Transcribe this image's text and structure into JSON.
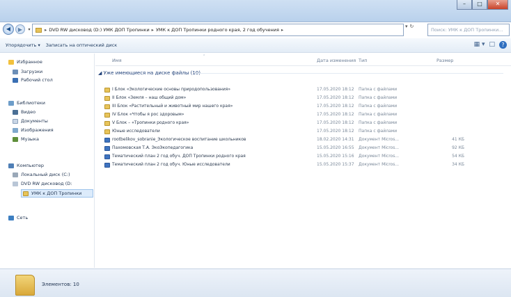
{
  "window": {
    "buttons": {
      "minimize": "–",
      "maximize": "□",
      "close": "✕"
    }
  },
  "nav": {
    "back": "◀",
    "forward": "▶",
    "dropdown": "▾"
  },
  "address": {
    "crumbs": [
      "DVD RW дисковод (D:) УМК ДОП Тропинки",
      "УМК к ДОП Тропинки родного края, 2 год обучения"
    ],
    "separator": "▸",
    "dropdown": "▾",
    "refresh": "↻",
    "search_placeholder": "Поиск: УМК к ДОП Тропинки..."
  },
  "toolbar": {
    "organize": "Упорядочить ▾",
    "burn": "Записать на оптический диск",
    "views": "▦ ▾",
    "pane": "□",
    "help": "?"
  },
  "sidebar": {
    "favorites": {
      "label": "Избранное",
      "icon": "star-icon"
    },
    "downloads": {
      "label": "Загрузки",
      "icon": "downloads-icon"
    },
    "desktop": {
      "label": "Рабочий стол",
      "icon": "desktop-icon"
    },
    "libraries": {
      "label": "Библиотеки",
      "icon": "library-icon"
    },
    "video": {
      "label": "Видео",
      "icon": "video-icon"
    },
    "documents": {
      "label": "Документы",
      "icon": "documents-icon"
    },
    "images": {
      "label": "Изображения",
      "icon": "images-icon"
    },
    "music": {
      "label": "Музыка",
      "icon": "music-icon"
    },
    "computer": {
      "label": "Компьютер",
      "icon": "computer-icon"
    },
    "localdisk": {
      "label": "Локальный диск (C:)",
      "icon": "disk-icon"
    },
    "dvd": {
      "label": "DVD RW дисковод (D:",
      "icon": "dvd-icon"
    },
    "current": {
      "label": "УМК к ДОП Тропинки",
      "icon": "folder-icon"
    },
    "network": {
      "label": "Сеть",
      "icon": "network-icon"
    }
  },
  "columns": {
    "name": "Имя",
    "date": "Дата изменения",
    "type": "Тип",
    "size": "Размер"
  },
  "group": {
    "label": "◢ Уже имеющиеся на диске файлы (10)"
  },
  "files": [
    {
      "name": "I Блок «Экологические основы природопользования»",
      "date": "17.05.2020 18:12",
      "type": "Папка с файлами",
      "size": "",
      "kind": "folder"
    },
    {
      "name": "II Блок «Земля – наш общий дом»",
      "date": "17.05.2020 18:12",
      "type": "Папка с файлами",
      "size": "",
      "kind": "folder"
    },
    {
      "name": "III Блок «Растительный и животный мир нашего края»",
      "date": "17.05.2020 18:12",
      "type": "Папка с файлами",
      "size": "",
      "kind": "folder"
    },
    {
      "name": "IV Блок «Чтобы я рос здоровым»",
      "date": "17.05.2020 18:12",
      "type": "Папка с файлами",
      "size": "",
      "kind": "folder"
    },
    {
      "name": "V Блок – «Тропинки родного края»",
      "date": "17.05.2020 18:12",
      "type": "Папка с файлами",
      "size": "",
      "kind": "folder"
    },
    {
      "name": "Юные исследователи",
      "date": "17.05.2020 18:12",
      "type": "Папка с файлами",
      "size": "",
      "kind": "folder"
    },
    {
      "name": "rootbelikov_sobranie_Экологическое воспитание школьников",
      "date": "18.02.2020 14:31",
      "type": "Документ Micros...",
      "size": "41 КБ",
      "kind": "docx"
    },
    {
      "name": "Пахомовская Т.А. ЭкоЭкопедагогика",
      "date": "15.05.2020 16:55",
      "type": "Документ Micros...",
      "size": "92 КБ",
      "kind": "docx"
    },
    {
      "name": "Тематический план 2 год обуч. ДОП Тропинки родного края",
      "date": "15.05.2020 15:16",
      "type": "Документ Micros...",
      "size": "54 КБ",
      "kind": "docx"
    },
    {
      "name": "Тематический план 2 год обуч. Юные исследователи",
      "date": "15.05.2020 15:37",
      "type": "Документ Micros...",
      "size": "34 КБ",
      "kind": "docx"
    }
  ],
  "status": {
    "count": "Элементов: 10"
  }
}
